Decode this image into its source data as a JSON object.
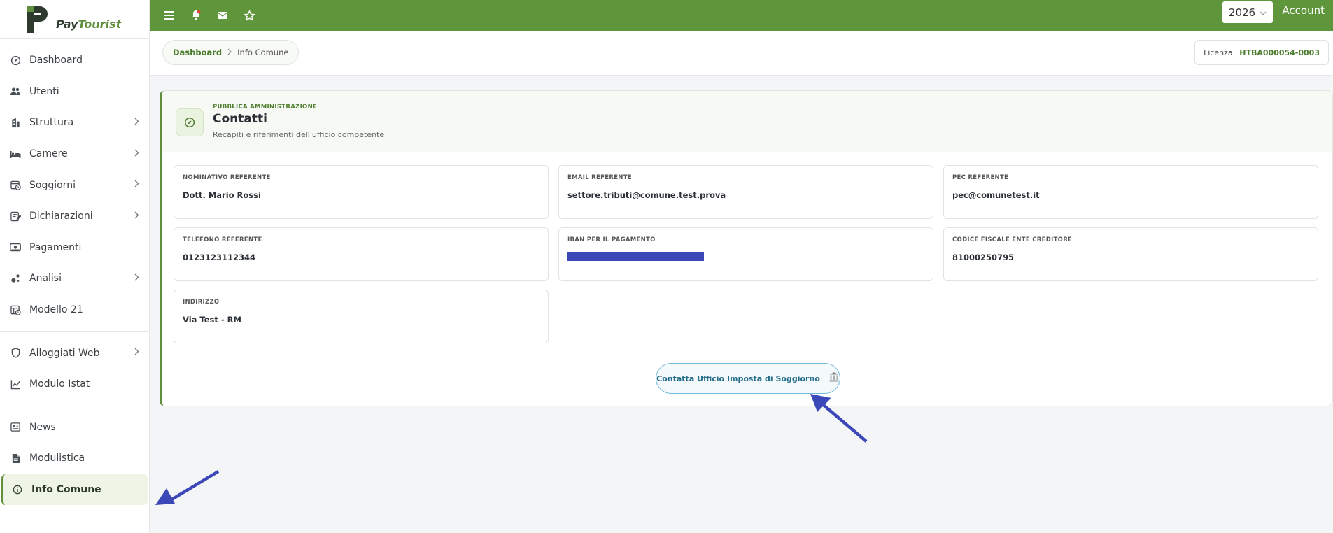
{
  "app": {
    "logo_pay": "Pay",
    "logo_tourist": "Tourist"
  },
  "sidebar": {
    "groups": [
      [
        {
          "label": "Dashboard",
          "icon": "dashboard-icon",
          "chevron": false
        },
        {
          "label": "Utenti",
          "icon": "users-icon",
          "chevron": false
        },
        {
          "label": "Struttura",
          "icon": "building-icon",
          "chevron": true
        },
        {
          "label": "Camere",
          "icon": "bed-icon",
          "chevron": true
        },
        {
          "label": "Soggiorni",
          "icon": "calendar-clock-icon",
          "chevron": true
        },
        {
          "label": "Dichiarazioni",
          "icon": "declaration-icon",
          "chevron": true
        },
        {
          "label": "Pagamenti",
          "icon": "payment-icon",
          "chevron": false
        },
        {
          "label": "Analisi",
          "icon": "analytics-icon",
          "chevron": true
        },
        {
          "label": "Modello 21",
          "icon": "model-icon",
          "chevron": false
        }
      ],
      [
        {
          "label": "Alloggiati Web",
          "icon": "shield-icon",
          "chevron": true
        },
        {
          "label": "Modulo Istat",
          "icon": "chart-icon",
          "chevron": false
        }
      ],
      [
        {
          "label": "News",
          "icon": "news-icon",
          "chevron": false
        },
        {
          "label": "Modulistica",
          "icon": "document-icon",
          "chevron": false
        },
        {
          "label": "Info Comune",
          "icon": "info-icon",
          "chevron": false,
          "active": true
        }
      ]
    ]
  },
  "topbar": {
    "year": "2026",
    "account_label": "Account"
  },
  "breadcrumb": {
    "home": "Dashboard",
    "current": "Info Comune"
  },
  "license": {
    "label": "Licenza:",
    "value": "HTBA000054-0003"
  },
  "card": {
    "kicker": "PUBBLICA AMMINISTRAZIONE",
    "title": "Contatti",
    "subtitle": "Recapiti e riferimenti dell'ufficio competente",
    "fields": [
      {
        "label": "NOMINATIVO REFERENTE",
        "value": "Dott. Mario Rossi"
      },
      {
        "label": "EMAIL REFERENTE",
        "value": "settore.tributi@comune.test.prova"
      },
      {
        "label": "PEC REFERENTE",
        "value": "pec@comunetest.it"
      },
      {
        "label": "TELEFONO REFERENTE",
        "value": "0123123112344"
      },
      {
        "label": "IBAN PER IL PAGAMENTO",
        "value": "",
        "redacted": true
      },
      {
        "label": "CODICE FISCALE ENTE CREDITORE",
        "value": "81000250795"
      },
      {
        "label": "INDIRIZZO",
        "value": "Via Test - RM"
      }
    ],
    "contact_button": "Contatta Ufficio Imposta di Soggiorno"
  },
  "colors": {
    "brand_green": "#5f963c",
    "dark_green": "#4d7d2e",
    "annotation_arrow": "#3d48b8",
    "redaction": "#3d48b8"
  }
}
